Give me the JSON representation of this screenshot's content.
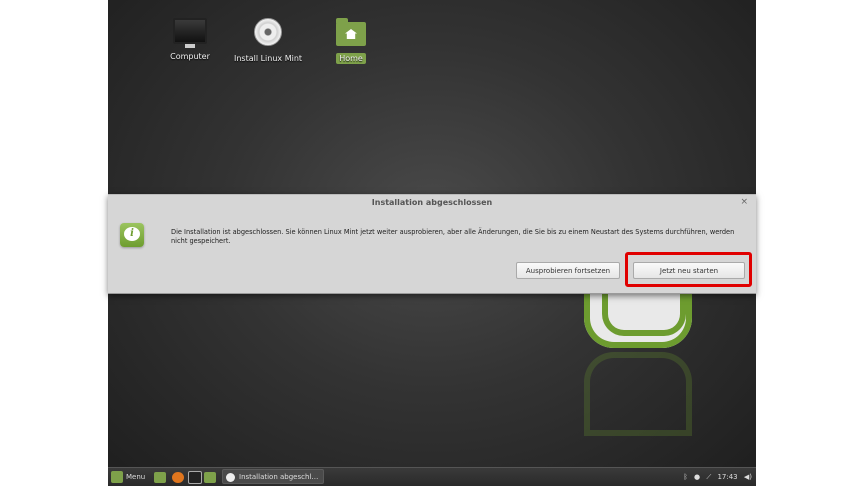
{
  "desktop": {
    "icons": [
      {
        "label": "Computer",
        "icon": "computer-icon"
      },
      {
        "label": "Install Linux Mint",
        "icon": "disc-icon"
      },
      {
        "label": "Home",
        "icon": "home-folder-icon"
      }
    ]
  },
  "dialog": {
    "title": "Installation abgeschlossen",
    "close_label": "×",
    "icon": "info-icon",
    "message": "Die Installation ist abgeschlossen. Sie können Linux Mint jetzt weiter ausprobieren, aber alle Änderungen, die Sie bis zu einem Neustart des Systems durchführen, werden nicht gespeichert.",
    "buttons": {
      "continue_trying": "Ausprobieren fortsetzen",
      "restart_now": "Jetzt neu starten"
    }
  },
  "panel": {
    "menu_label": "Menu",
    "task_label": "Installation abgeschl…",
    "clock": "17:43",
    "tray_icons": [
      "bluetooth-icon",
      "user-icon",
      "network-icon",
      "volume-icon"
    ]
  },
  "colors": {
    "accent": "#7ea14a",
    "highlight": "#e00000"
  }
}
